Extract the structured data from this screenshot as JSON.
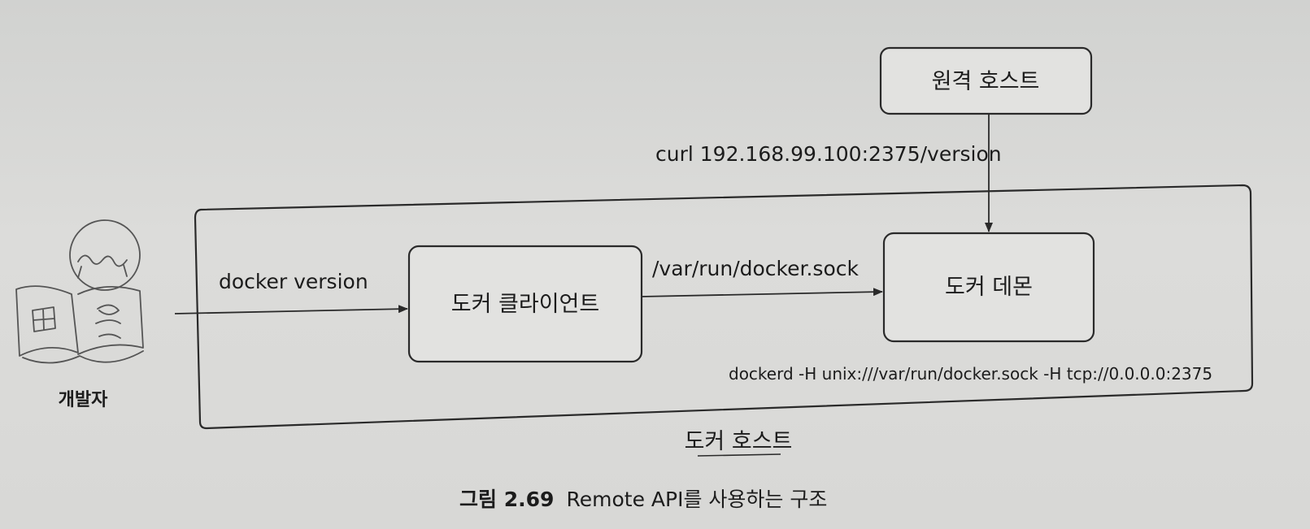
{
  "nodes": {
    "remote_host": "원격 호스트",
    "docker_client": "도커 클라이언트",
    "docker_daemon": "도커 데몬",
    "docker_host": "도커 호스트",
    "developer": "개발자"
  },
  "edges": {
    "developer_to_client": "docker version",
    "client_to_daemon": "/var/run/docker.sock",
    "remote_to_daemon": "curl 192.168.99.100:2375/version"
  },
  "daemon_command": "dockerd -H unix:///var/run/docker.sock -H tcp://0.0.0.0:2375",
  "caption": {
    "number": "그림 2.69",
    "text": "Remote API를 사용하는 구조"
  }
}
